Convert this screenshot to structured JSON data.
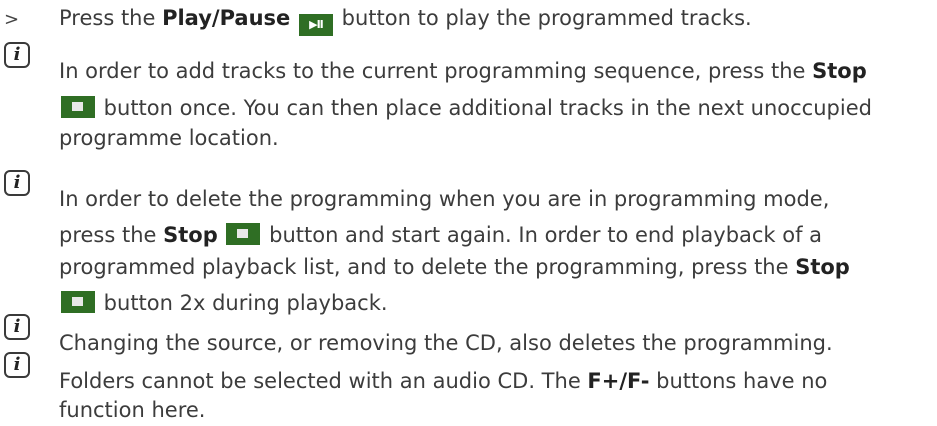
{
  "bullet": ">",
  "info_icon": "i",
  "icons": {
    "play_pause": "play-pause-button-icon",
    "stop": "stop-button-icon",
    "info": "info-icon"
  },
  "colors": {
    "button_bg": "#2f6e24",
    "text": "#3c3c3c"
  },
  "p1": {
    "pre": "Press the ",
    "bold": "Play/Pause",
    "post": " button to play the programmed tracks.",
    "glyph": "▶II"
  },
  "p2": {
    "l1_pre": "In order to add tracks to the current programming sequence, press the ",
    "l1_bold": "Stop",
    "l2": " button once. You can then place additional tracks in the next unoccupied",
    "l3": "programme location."
  },
  "p3": {
    "l1": "In order to delete the programming when you are in programming mode,",
    "l2_pre": "press the ",
    "l2_bold": "Stop",
    "l2_post": " button and start again. In order to end playback of a",
    "l3_pre": "programmed playback list, and to delete the programming, press the ",
    "l3_bold": "Stop",
    "l4": " button 2x during playback."
  },
  "p4": {
    "l1": "Changing the source, or removing the CD, also deletes the programming."
  },
  "p5": {
    "l1_pre": "Folders cannot be selected with an audio CD. The ",
    "l1_bold": "F+/F-",
    "l1_post": " buttons have no",
    "l2": "function here."
  }
}
